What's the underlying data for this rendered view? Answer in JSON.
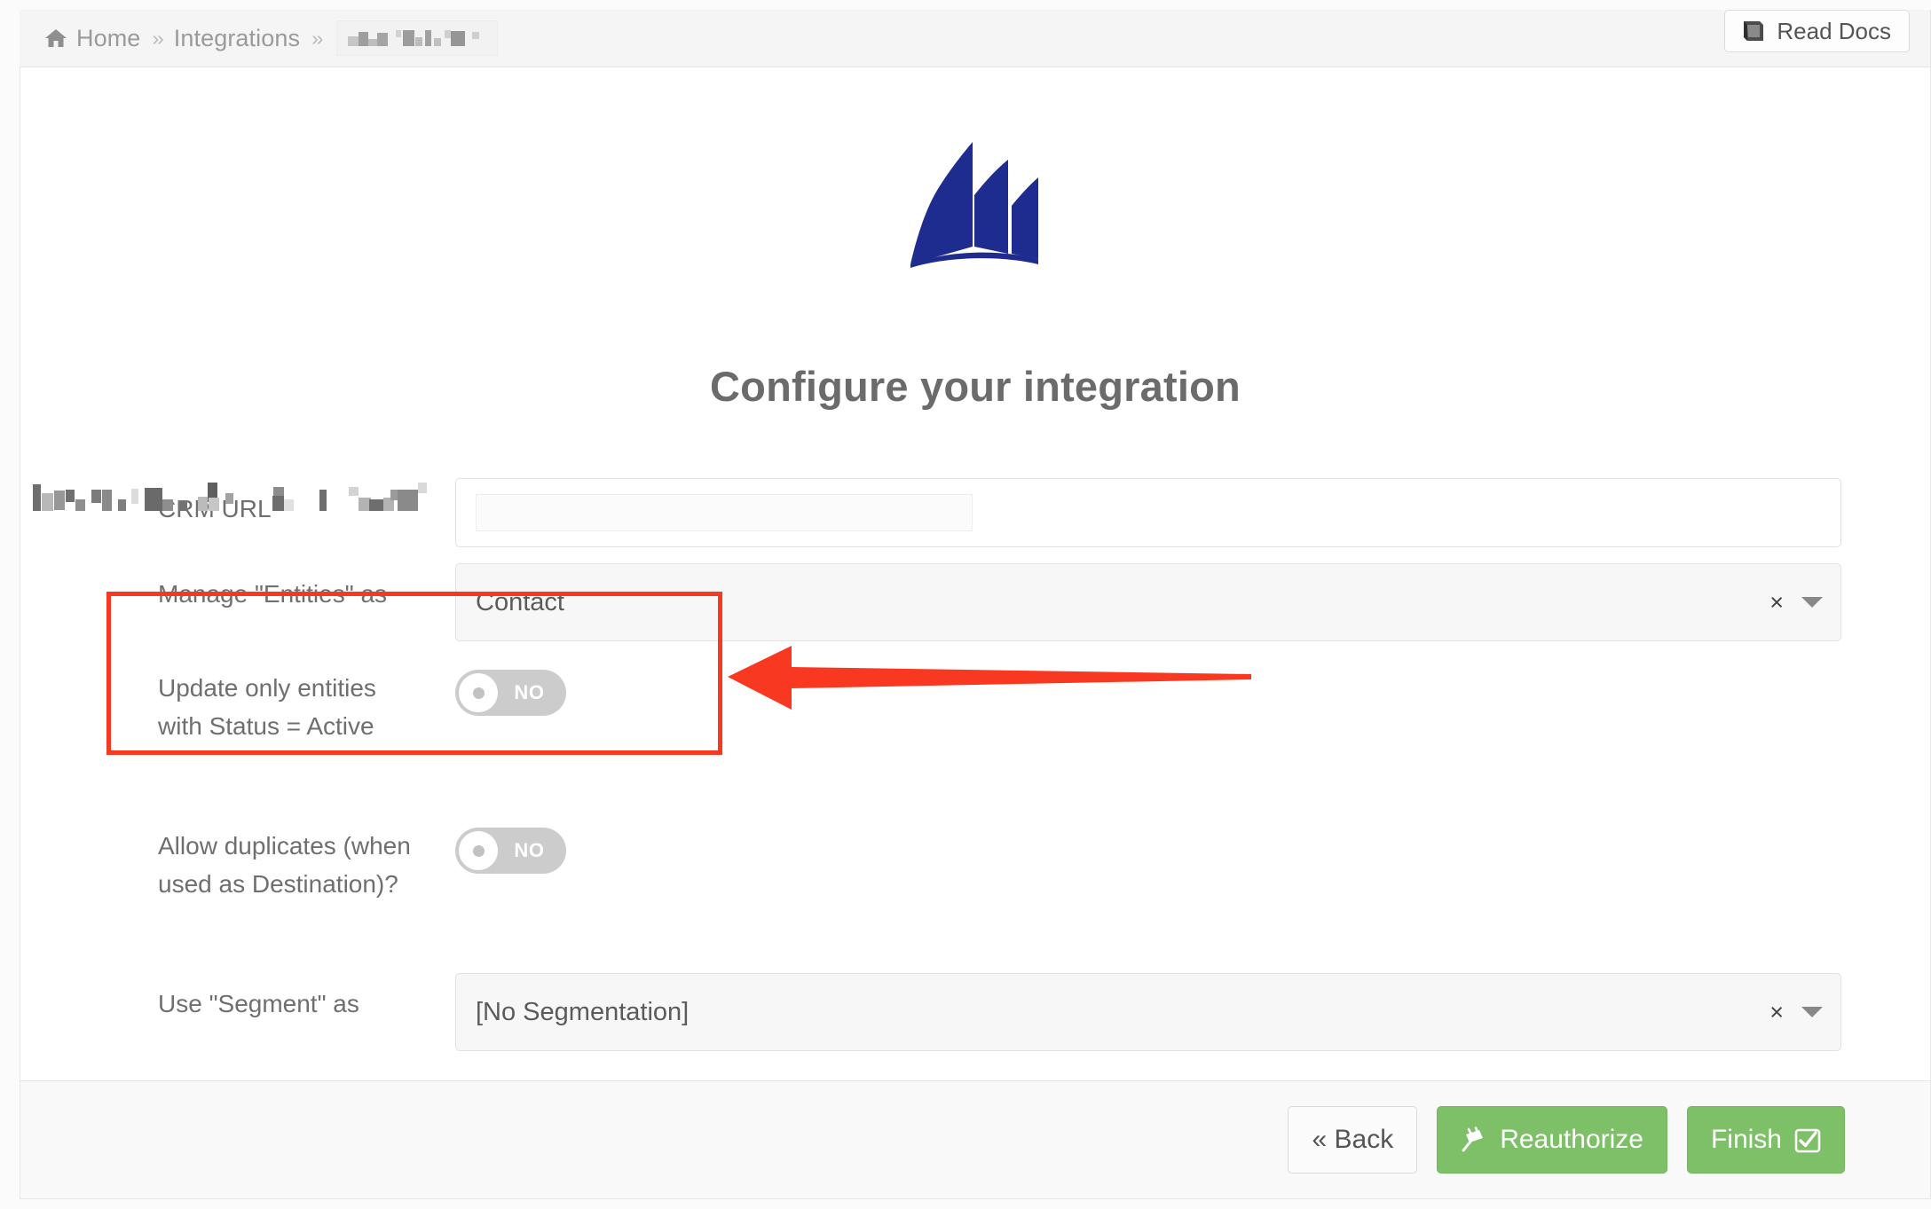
{
  "breadcrumb": {
    "home_label": "Home",
    "home_icon": "home-icon",
    "separator": "››",
    "integrations_label": "Integrations",
    "current_label": "",
    "current_redacted": true
  },
  "header": {
    "read_docs_label": "Read Docs",
    "read_docs_icon": "book-icon"
  },
  "main": {
    "logo_name": "microsoft-dynamics-logo",
    "logo_color": "#1f2c8f",
    "title": "Configure your integration"
  },
  "form": {
    "fields": [
      {
        "label": "CRM URL",
        "type": "text",
        "value": "",
        "redacted": true
      },
      {
        "label": "Manage \"Entities\" as",
        "type": "select",
        "value": "Contact",
        "clear_icon": "×",
        "caret_icon": "chevron-down-icon"
      },
      {
        "label": "Update only entities with Status = Active",
        "type": "toggle",
        "value": "NO",
        "on": false,
        "highlighted": true
      },
      {
        "label": "Allow duplicates (when used as Destination)?",
        "type": "toggle",
        "value": "NO",
        "on": false,
        "highlighted": false
      },
      {
        "label": "Use \"Segment\" as",
        "type": "select",
        "value": "[No Segmentation]",
        "clear_icon": "×",
        "caret_icon": "chevron-down-icon"
      }
    ]
  },
  "footer": {
    "back_label": "« Back",
    "reauthorize_label": "Reauthorize",
    "reauthorize_icon": "plug-icon",
    "finish_label": "Finish",
    "finish_icon": "check-square-icon"
  },
  "annotation": {
    "color": "#f93822",
    "shapes": [
      "highlight-rectangle",
      "pointer-arrow"
    ]
  },
  "colors": {
    "accent_green": "#7dc068",
    "annotation_red": "#f93822",
    "logo_blue": "#1f2c8f",
    "header_bg": "#f5f5f5",
    "footer_bg": "#f9f9f9"
  }
}
